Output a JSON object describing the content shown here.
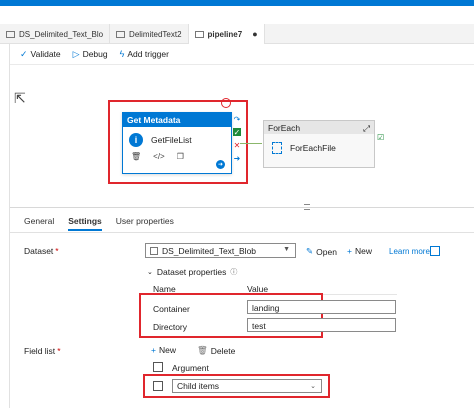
{
  "tabs": [
    {
      "label": "DS_Delimited_Text_Blo",
      "active": false
    },
    {
      "label": "DelimitedText2",
      "active": false
    },
    {
      "label": "pipeline7",
      "active": true,
      "dirty_marker": "●"
    }
  ],
  "toolbar": {
    "validate_label": "Validate",
    "debug_label": "Debug",
    "add_trigger_label": "Add trigger"
  },
  "activities": {
    "get_metadata": {
      "header": "Get Metadata",
      "name": "GetFileList"
    },
    "foreach": {
      "header": "ForEach",
      "name": "ForEachFile"
    }
  },
  "panel_tabs": [
    "General",
    "Settings",
    "User properties"
  ],
  "active_panel_tab": "Settings",
  "settings": {
    "dataset_label": "Dataset",
    "required_marker": "*",
    "dataset_value": "DS_Delimited_Text_Blob",
    "open_label": "Open",
    "new_label": "New",
    "learn_more_label": "Learn more",
    "dataset_properties_label": "Dataset properties",
    "col_name": "Name",
    "col_value": "Value",
    "properties": [
      {
        "name": "Container",
        "value": "landing"
      },
      {
        "name": "Directory",
        "value": "test"
      }
    ],
    "field_list_label": "Field list",
    "field_new_label": "New",
    "field_delete_label": "Delete",
    "argument_header": "Argument",
    "field_value": "Child items"
  },
  "colors": {
    "accent": "#0078d4",
    "highlight_red": "#e0262d",
    "success_green": "#1d8a3a"
  }
}
